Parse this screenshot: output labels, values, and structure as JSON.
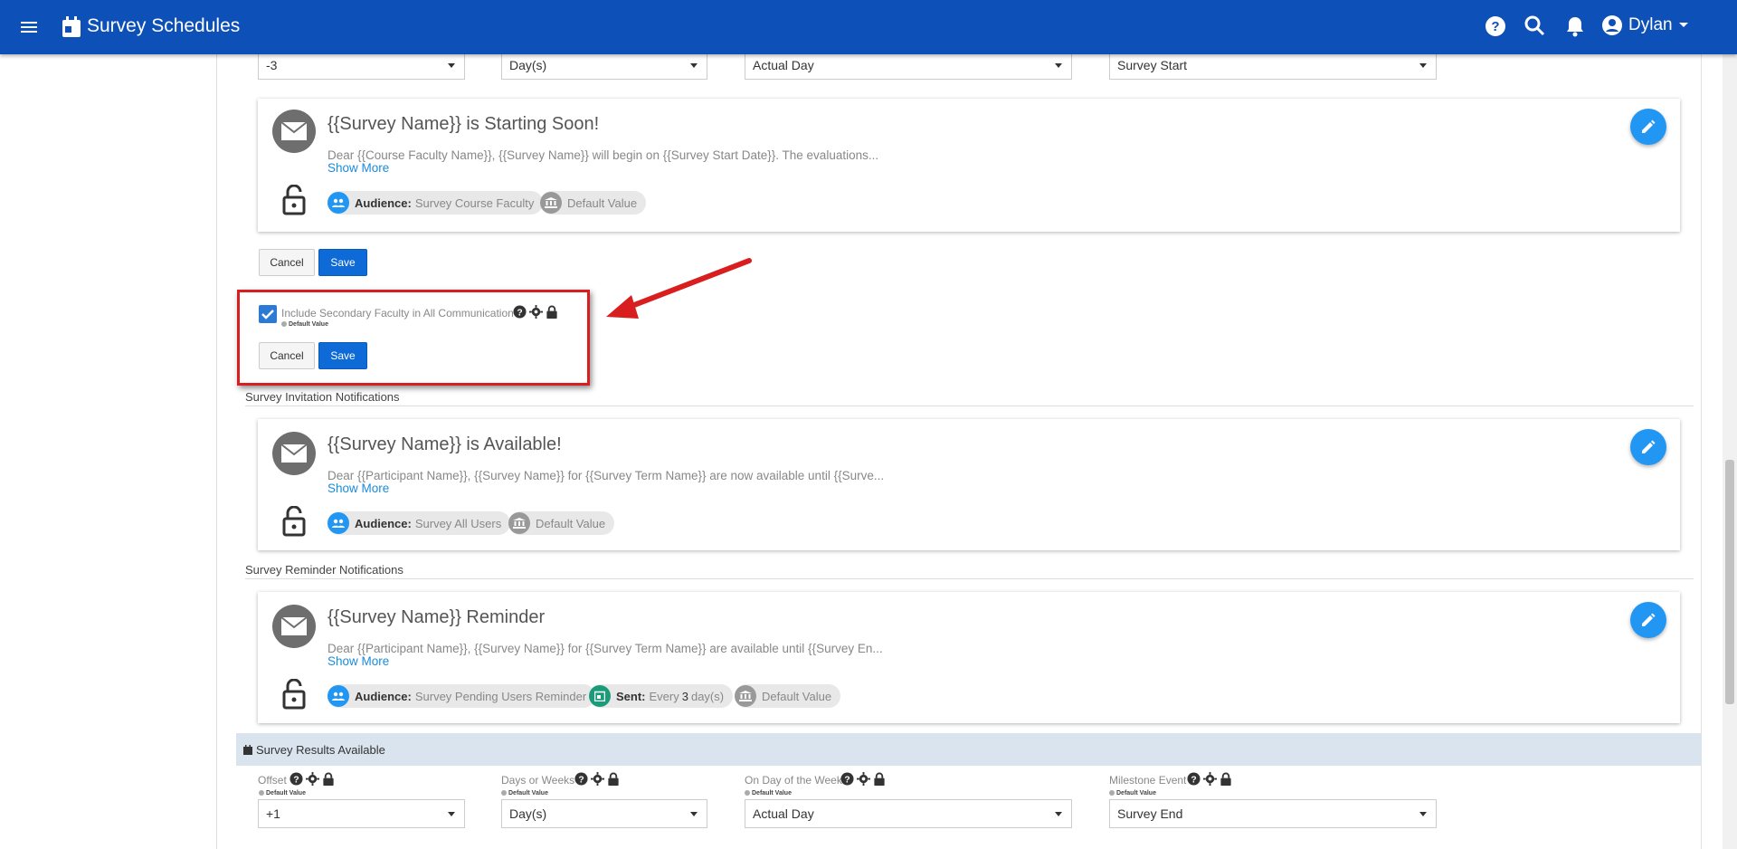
{
  "header": {
    "title": "Survey Schedules",
    "user_name": "Dylan",
    "icons": [
      "menu-icon",
      "calendar-icon",
      "help-icon",
      "search-icon",
      "bell-icon",
      "account-icon"
    ]
  },
  "top_selects": {
    "offset": "-3",
    "days_or_weeks": "Day(s)",
    "day_of_week": "Actual Day",
    "milestone": "Survey Start"
  },
  "starting_soon_card": {
    "title": "{{Survey Name}} is Starting Soon!",
    "body": "Dear {{Course Faculty Name}}, {{Survey Name}} will begin on {{Survey Start Date}}. The evaluations...",
    "show_more": "Show More",
    "audience_label": "Audience:",
    "audience_value": "Survey Course Faculty",
    "default_value": "Default Value"
  },
  "buttons": {
    "cancel": "Cancel",
    "save": "Save"
  },
  "secondary_faculty": {
    "checked": true,
    "label": "Include Secondary Faculty in All Communication",
    "default_value": "Default Value"
  },
  "invitation_section": {
    "heading": "Survey Invitation Notifications",
    "title": "{{Survey Name}} is Available!",
    "body": "Dear {{Participant Name}}, {{Survey Name}} for {{Survey Term Name}} are now available until {{Surve...",
    "show_more": "Show More",
    "audience_label": "Audience:",
    "audience_value": "Survey All Users",
    "default_value": "Default Value"
  },
  "reminder_section": {
    "heading": "Survey Reminder Notifications",
    "title": "{{Survey Name}} Reminder",
    "body": "Dear {{Participant Name}}, {{Survey Name}} for {{Survey Term Name}} are available until {{Survey En...",
    "show_more": "Show More",
    "audience_label": "Audience:",
    "audience_value": "Survey Pending Users Reminder",
    "sent_label": "Sent:",
    "sent_every": "Every",
    "sent_count": "3",
    "sent_unit": "day(s)",
    "default_value": "Default Value"
  },
  "results_section": {
    "heading": "Survey Results Available",
    "fields": {
      "offset_label": "Offset",
      "days_or_weeks_label": "Days or Weeks",
      "day_of_week_label": "On Day of the Week",
      "milestone_label": "Milestone Event",
      "default_value": "Default Value"
    },
    "values": {
      "offset": "+1",
      "days_or_weeks": "Day(s)",
      "day_of_week": "Actual Day",
      "milestone": "Survey End"
    }
  },
  "colors": {
    "header_bg": "#0d50b8",
    "accent_blue": "#2196f3",
    "save_blue": "#0d6ad6",
    "highlight_red": "#d81e1e",
    "results_bar": "#d9e4ee",
    "sent_green": "#1a9c7a"
  }
}
